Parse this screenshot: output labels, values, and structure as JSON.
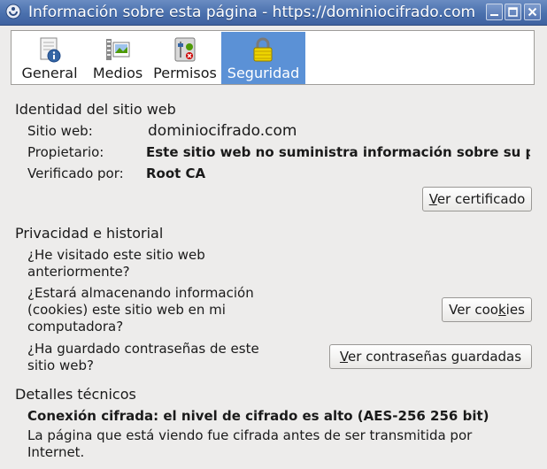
{
  "window": {
    "title": "Información sobre esta página - https://dominiocifrado.com",
    "minimize_icon": "minimize-icon",
    "maximize_icon": "maximize-icon",
    "close_icon": "close-icon"
  },
  "tabs": [
    {
      "label": "General",
      "icon": "info-document-icon"
    },
    {
      "label": "Medios",
      "icon": "media-images-icon"
    },
    {
      "label": "Permisos",
      "icon": "permissions-icon"
    },
    {
      "label": "Seguridad",
      "icon": "padlock-icon",
      "active": true
    }
  ],
  "identity": {
    "heading": "Identidad del sitio web",
    "site_label": "Sitio web:",
    "site_value": "dominiocifrado.com",
    "owner_label": "Propietario:",
    "owner_value": "Este sitio web no suministra información sobre su propietario.",
    "verified_label": "Verificado por:",
    "verified_value": "Root CA",
    "view_cert_pre": "",
    "view_cert_key": "V",
    "view_cert_post": "er certificado"
  },
  "privacy": {
    "heading": "Privacidad e historial",
    "q_visited": "¿He visitado este sitio web anteriormente?",
    "q_cookies": "¿Estará almacenando información (cookies) este sitio web en mi computadora?",
    "q_passwords": "¿Ha guardado contraseñas de este sitio web?",
    "cookies_pre": "Ver coo",
    "cookies_key": "k",
    "cookies_post": "ies",
    "passwords_pre": "",
    "passwords_key": "V",
    "passwords_post": "er contraseñas guardadas"
  },
  "technical": {
    "heading": "Detalles técnicos",
    "connection": "Conexión cifrada: el nivel de cifrado es alto (AES-256 256 bit)",
    "description": "La página que está viendo fue cifrada antes de ser transmitida por Internet."
  },
  "colors": {
    "titlebar": "#4a70ad",
    "active_tab": "#5b91d6",
    "background": "#edeceb"
  }
}
